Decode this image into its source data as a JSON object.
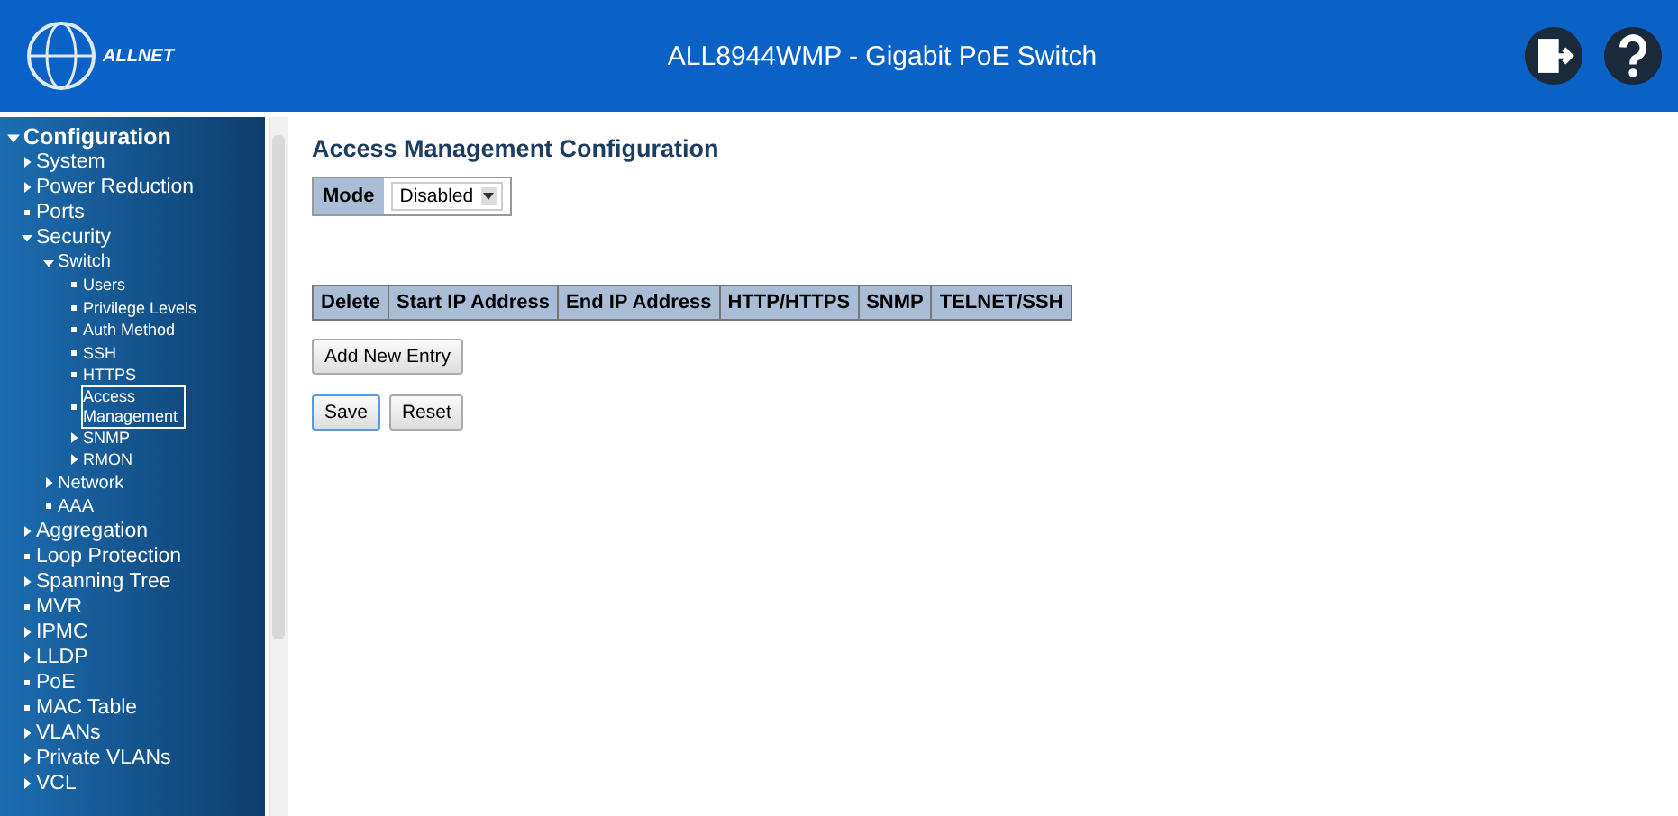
{
  "header": {
    "logo_text": "ALLNET",
    "title": "ALL8944WMP - Gigabit PoE Switch"
  },
  "sidebar": {
    "items": [
      {
        "label": "Configuration",
        "kind": "folder",
        "expanded": true,
        "selected": false,
        "children": [
          {
            "label": "System",
            "kind": "folder",
            "expanded": false,
            "selected": false
          },
          {
            "label": "Power Reduction",
            "kind": "folder",
            "expanded": false,
            "selected": false
          },
          {
            "label": "Ports",
            "kind": "leaf",
            "selected": false
          },
          {
            "label": "Security",
            "kind": "folder",
            "expanded": true,
            "selected": false,
            "children": [
              {
                "label": "Switch",
                "kind": "folder",
                "expanded": true,
                "selected": false,
                "children": [
                  {
                    "label": "Users",
                    "kind": "leaf",
                    "selected": false
                  },
                  {
                    "label": "Privilege Levels",
                    "kind": "leaf",
                    "selected": false
                  },
                  {
                    "label": "Auth Method",
                    "kind": "leaf",
                    "selected": false
                  },
                  {
                    "label": "SSH",
                    "kind": "leaf",
                    "selected": false
                  },
                  {
                    "label": "HTTPS",
                    "kind": "leaf",
                    "selected": false
                  },
                  {
                    "label": "Access Management",
                    "kind": "leaf",
                    "selected": true
                  },
                  {
                    "label": "SNMP",
                    "kind": "folder",
                    "expanded": false,
                    "selected": false
                  },
                  {
                    "label": "RMON",
                    "kind": "folder",
                    "expanded": false,
                    "selected": false
                  }
                ]
              },
              {
                "label": "Network",
                "kind": "folder",
                "expanded": false,
                "selected": false
              },
              {
                "label": "AAA",
                "kind": "leaf",
                "selected": false
              }
            ]
          },
          {
            "label": "Aggregation",
            "kind": "folder",
            "expanded": false,
            "selected": false
          },
          {
            "label": "Loop Protection",
            "kind": "leaf",
            "selected": false
          },
          {
            "label": "Spanning Tree",
            "kind": "folder",
            "expanded": false,
            "selected": false
          },
          {
            "label": "MVR",
            "kind": "leaf",
            "selected": false
          },
          {
            "label": "IPMC",
            "kind": "folder",
            "expanded": false,
            "selected": false
          },
          {
            "label": "LLDP",
            "kind": "folder",
            "expanded": false,
            "selected": false
          },
          {
            "label": "PoE",
            "kind": "leaf",
            "selected": false
          },
          {
            "label": "MAC Table",
            "kind": "leaf",
            "selected": false
          },
          {
            "label": "VLANs",
            "kind": "folder",
            "expanded": false,
            "selected": false
          },
          {
            "label": "Private VLANs",
            "kind": "folder",
            "expanded": false,
            "selected": false
          },
          {
            "label": "VCL",
            "kind": "folder",
            "expanded": false,
            "selected": false
          }
        ]
      }
    ]
  },
  "main": {
    "title": "Access Management Configuration",
    "mode": {
      "label": "Mode",
      "value": "Disabled"
    },
    "table": {
      "columns": [
        "Delete",
        "Start IP Address",
        "End IP Address",
        "HTTP/HTTPS",
        "SNMP",
        "TELNET/SSH"
      ]
    },
    "add_button": "Add New Entry",
    "buttons": [
      "Save",
      "Reset"
    ]
  }
}
